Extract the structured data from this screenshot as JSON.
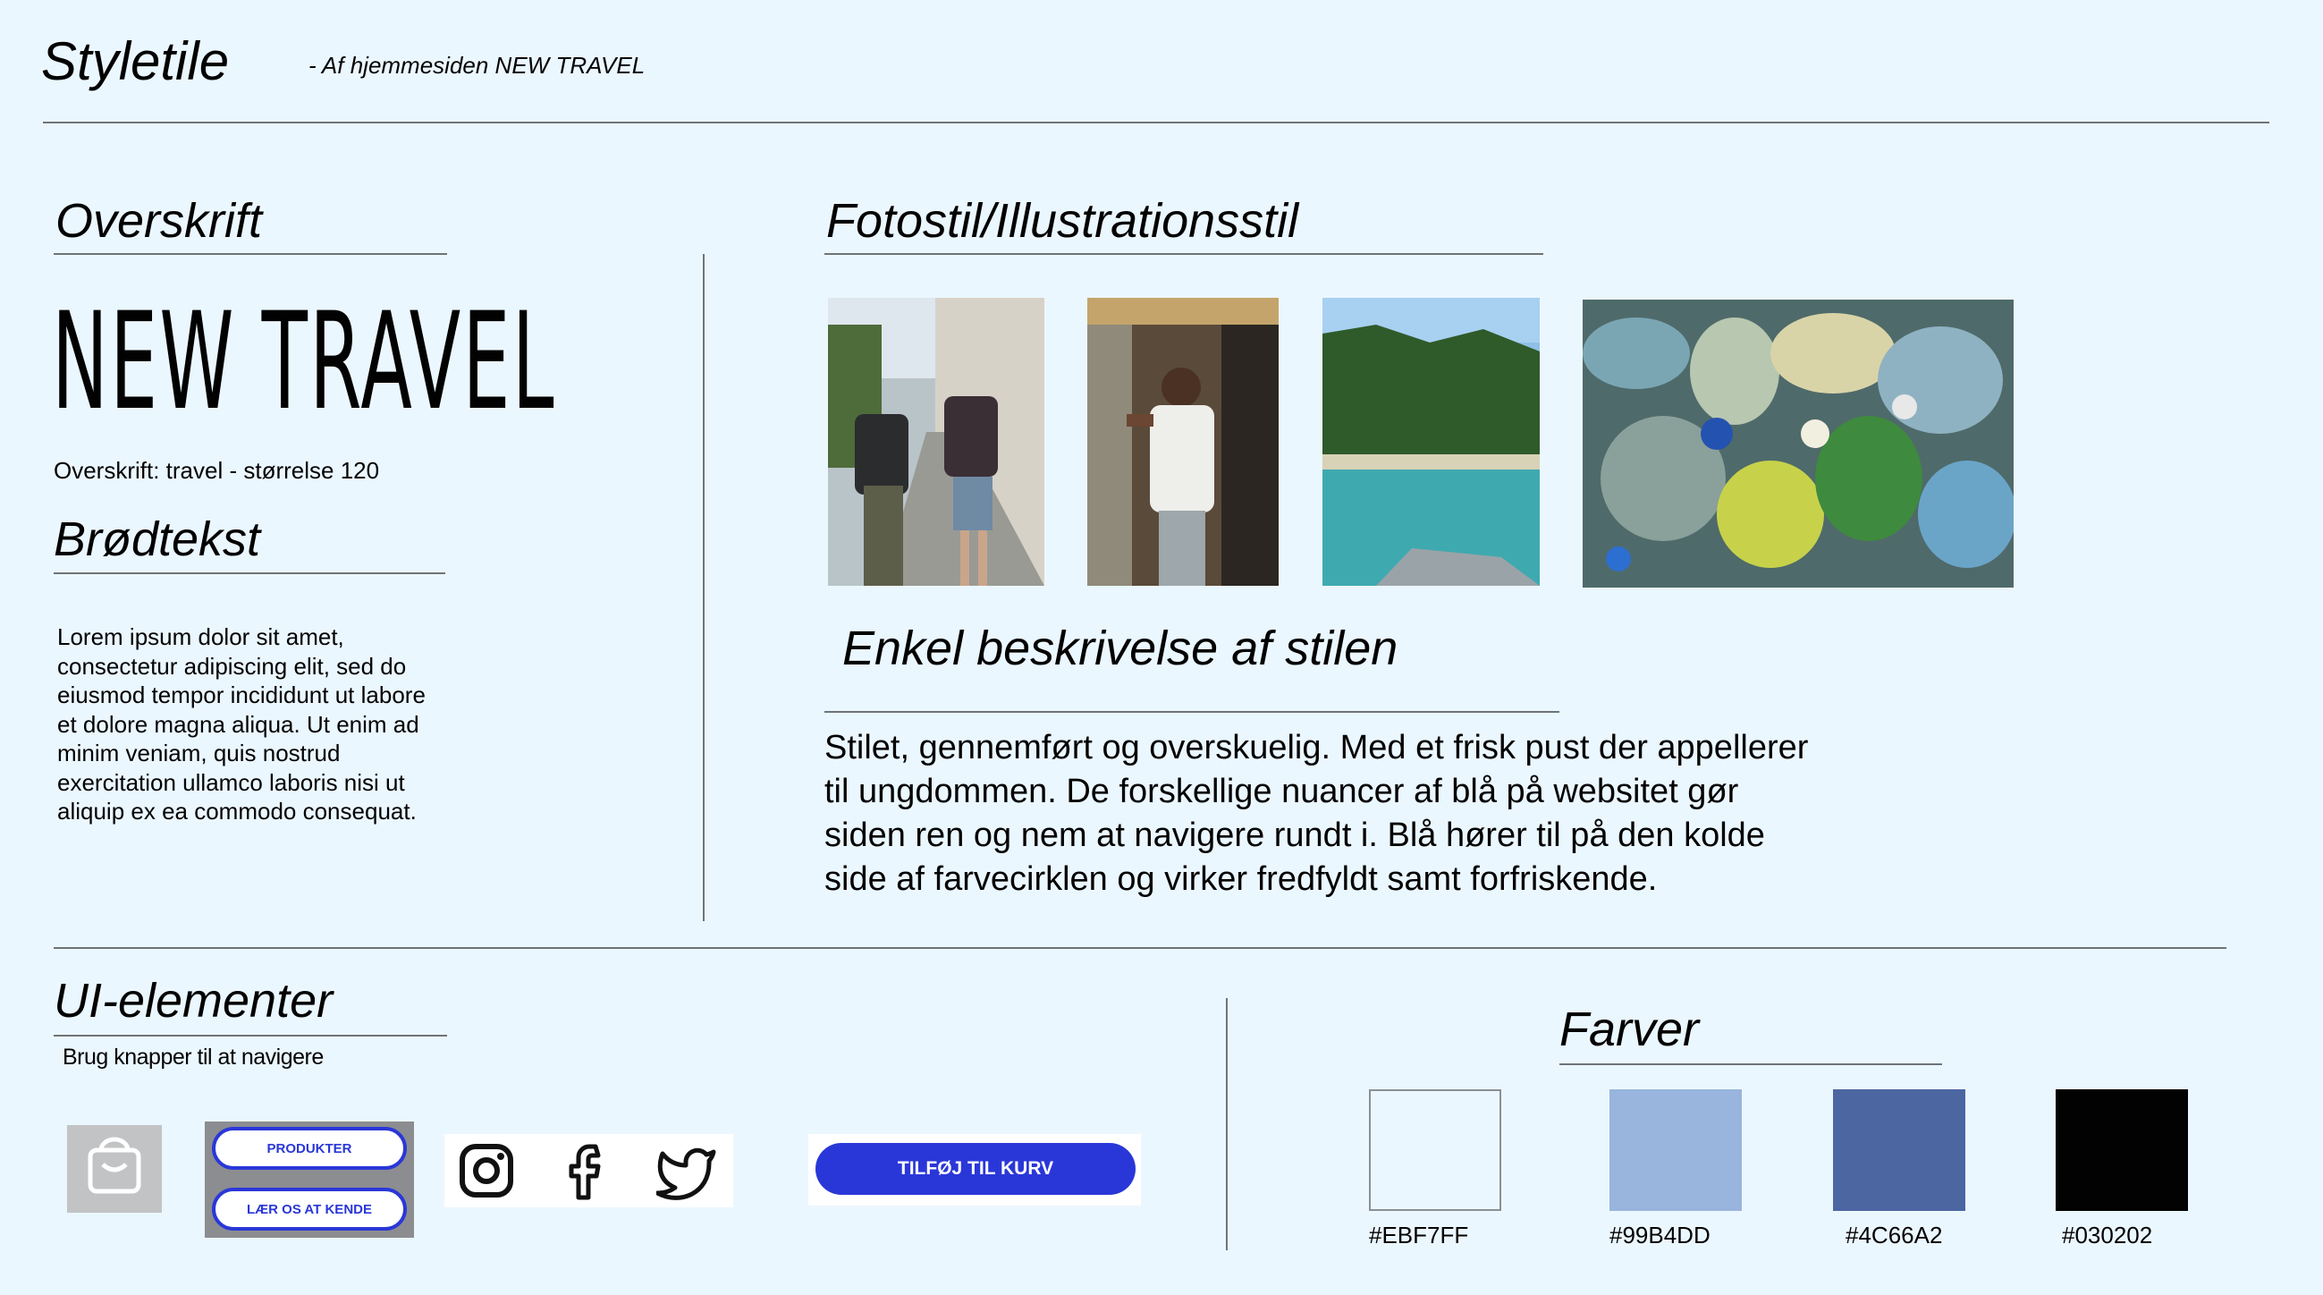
{
  "header": {
    "title": "Styletile",
    "subtitle": "- Af hjemmesiden NEW TRAVEL"
  },
  "overskrift": {
    "heading": "Overskrift",
    "sample": "NEW TRAVEL",
    "caption": "Overskrift: travel - størrelse 120"
  },
  "brodtekst": {
    "heading": "Brødtekst",
    "lines": [
      "Lorem ipsum dolor sit amet,",
      "consectetur adipiscing elit, sed do",
      "eiusmod tempor incididunt ut labore",
      "et dolore magna aliqua. Ut enim ad",
      "minim veniam, quis nostrud",
      "exercitation ullamco laboris nisi ut",
      "aliquip ex ea commodo consequat."
    ]
  },
  "fotostil": {
    "heading": "Fotostil/Illustrationsstil",
    "description_heading": "Enkel beskrivelse af stilen",
    "description_lines": [
      "Stilet, gennemført og overskuelig. Med et frisk pust der appellerer",
      "til ungdommen. De forskellige nuancer af blå på websitet gør",
      "siden ren og nem at navigere rundt i. Blå hører til på den kolde",
      "side af farvecirklen og virker fredfyldt samt forfriskende."
    ]
  },
  "ui": {
    "heading": "UI-elementer",
    "subtitle": "Brug knapper til at navigere",
    "buttons": {
      "produkter": "PRODUKTER",
      "laer": "LÆR OS AT KENDE",
      "cart": "TILFØJ TIL KURV"
    },
    "icons": [
      "shopping-bag-icon",
      "instagram-icon",
      "facebook-icon",
      "twitter-icon"
    ]
  },
  "farver": {
    "heading": "Farver",
    "colors": [
      {
        "hex": "#EBF7FF",
        "label": "#EBF7FF"
      },
      {
        "hex": "#99B4DD",
        "label": "#99B4DD"
      },
      {
        "hex": "#4C66A2",
        "label": "#4C66A2"
      },
      {
        "hex": "#030202",
        "label": "#030202"
      }
    ]
  },
  "colors": {
    "background": "#EBF7FF",
    "accent_button": "#2a37d8"
  }
}
